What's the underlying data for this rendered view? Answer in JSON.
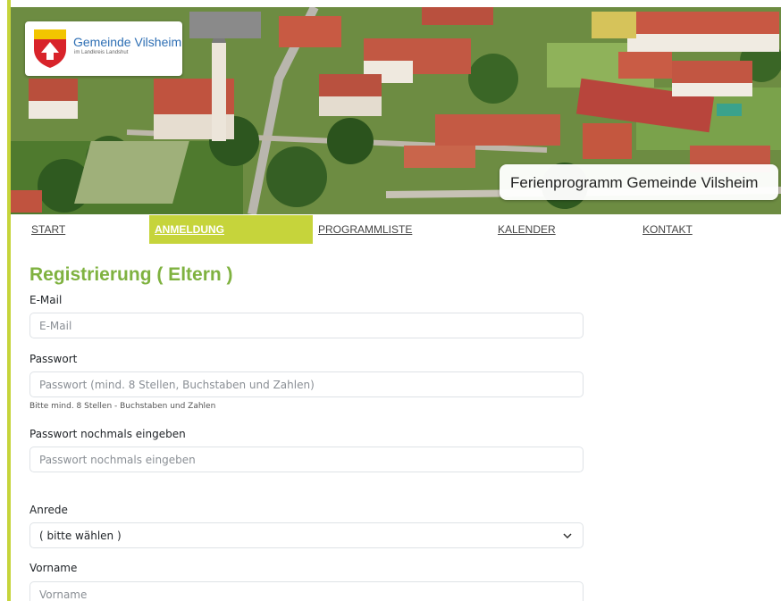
{
  "header": {
    "logo_name": "Gemeinde Vilsheim",
    "logo_sub": "im Landkreis Landshut",
    "banner_title": "Ferienprogramm Gemeinde Vilsheim"
  },
  "nav": {
    "items": [
      {
        "label": "START",
        "active": false
      },
      {
        "label": "ANMELDUNG",
        "active": true
      },
      {
        "label": "PROGRAMMLISTE",
        "active": false
      },
      {
        "label": "KALENDER",
        "active": false
      },
      {
        "label": "KONTAKT",
        "active": false
      }
    ]
  },
  "form": {
    "heading": "Registrierung ( Eltern )",
    "email": {
      "label": "E-Mail",
      "placeholder": "E-Mail",
      "value": ""
    },
    "password": {
      "label": "Passwort",
      "placeholder": "Passwort (mind. 8 Stellen, Buchstaben und Zahlen)",
      "value": "",
      "hint": "Bitte mind. 8 Stellen - Buchstaben und Zahlen"
    },
    "password_repeat": {
      "label": "Passwort nochmals eingeben",
      "placeholder": "Passwort nochmals eingeben",
      "value": ""
    },
    "salutation": {
      "label": "Anrede",
      "selected": "( bitte wählen )"
    },
    "firstname": {
      "label": "Vorname",
      "placeholder": "Vorname",
      "value": ""
    }
  },
  "colors": {
    "accent": "#c6d43b",
    "heading": "#7fb240",
    "logo_text": "#2e6fb4"
  },
  "icons": {
    "crest": "municipal-crest-icon",
    "select": "chevron-down-icon"
  }
}
